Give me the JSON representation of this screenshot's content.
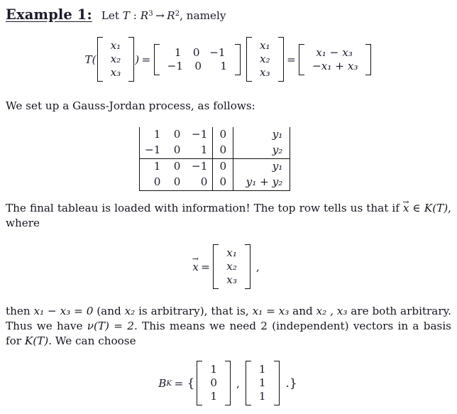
{
  "heading": {
    "label": "Example 1:",
    "text_parts": {
      "lead": "Let ",
      "map_name": "T",
      "colon": " : ",
      "domain_base": "R",
      "domain_exp": "3",
      "arrow": "→",
      "codomain_base": "R",
      "codomain_exp": "2",
      "tail": ", namely"
    }
  },
  "eq_transform": {
    "name": "transform-definition",
    "fn_open": "T(",
    "fn_close": ")",
    "equals": "=",
    "input_vector": [
      "x₁",
      "x₂",
      "x₃"
    ],
    "matrix_rows": [
      [
        "1",
        "0",
        "−1"
      ],
      [
        "−1",
        "0",
        "1"
      ]
    ],
    "times_vector": [
      "x₁",
      "x₂",
      "x₃"
    ],
    "result_vector": [
      "x₁ − x₃",
      "−x₁ + x₃"
    ]
  },
  "p_setup": "We set up a Gauss-Jordan process, as follows:",
  "tableau": {
    "name": "gauss-jordan-tableau",
    "rows": [
      {
        "coeffs": [
          "1",
          "0",
          "−1"
        ],
        "zero": "0",
        "rhs": "y₁",
        "rule_above": false,
        "rule_below": false
      },
      {
        "coeffs": [
          "−1",
          "0",
          "1"
        ],
        "zero": "0",
        "rhs": "y₂",
        "rule_above": false,
        "rule_below": true
      },
      {
        "coeffs": [
          "1",
          "0",
          "−1"
        ],
        "zero": "0",
        "rhs": "y₁",
        "rule_above": false,
        "rule_below": false
      },
      {
        "coeffs": [
          "0",
          "0",
          "0"
        ],
        "zero": "0",
        "rhs": "y₁ + y₂",
        "rule_above": false,
        "rule_below": true
      }
    ]
  },
  "p_final": {
    "s1": "The final tableau is loaded with information!  The top row tells us that if ",
    "xvec": "x",
    "in": " ∈ ",
    "kt": "K(T)",
    "s2": ", where"
  },
  "eq_xvec": {
    "name": "x-vector-definition",
    "lhs": "x",
    "equals": "=",
    "entries": [
      "x₁",
      "x₂",
      "x₃"
    ],
    "trailing_comma": ","
  },
  "p_then": {
    "t1": "then ",
    "m1": "x₁ − x₃ = 0",
    "t2": " (and ",
    "m2": "x₂",
    "t3": " is arbitrary), that is, ",
    "m3": "x₁ = x₃",
    "t4": " and ",
    "m4": "x₂ , x₃",
    "t5": " are both arbitrary.  Thus we have ",
    "m5": "ν(T) = 2",
    "t6": ".  This means we need 2 (independent) vectors in a basis for ",
    "m6": "K(T)",
    "t7": ".  We can choose"
  },
  "eq_basis": {
    "name": "kernel-basis",
    "lhs_base": "B",
    "lhs_sub": "K",
    "equals": "=",
    "open_brace": "{",
    "vector1": [
      "1",
      "0",
      "1"
    ],
    "separator": ",",
    "vector2": [
      "1",
      "1",
      "1"
    ],
    "close_brace": ".}"
  },
  "colors": {
    "text": "#15151f",
    "rule": "#111111",
    "background": "#ffffff"
  }
}
